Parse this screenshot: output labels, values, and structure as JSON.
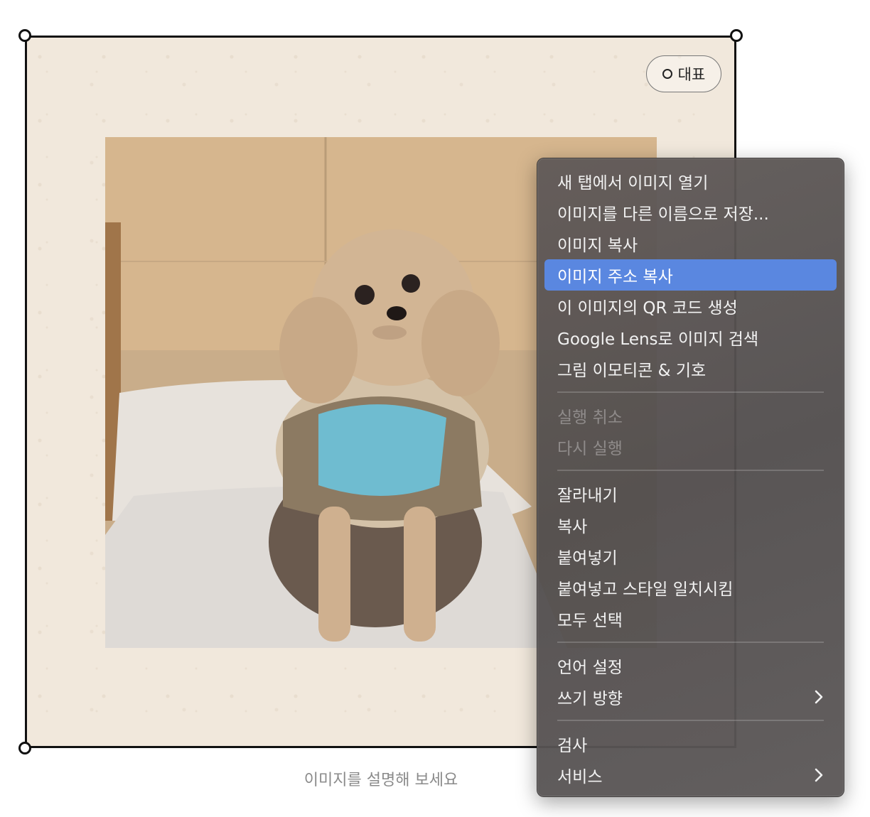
{
  "image_block": {
    "representative_label": "대표",
    "caption_placeholder": "이미지를 설명해 보세요"
  },
  "context_menu": {
    "group_image": [
      {
        "label": "새 탭에서 이미지 열기"
      },
      {
        "label": "이미지를 다른 이름으로 저장..."
      },
      {
        "label": "이미지 복사"
      },
      {
        "label": "이미지 주소 복사",
        "highlighted": true
      },
      {
        "label": "이 이미지의 QR 코드 생성"
      },
      {
        "label": "Google Lens로 이미지 검색"
      },
      {
        "label": "그림 이모티콘 & 기호"
      }
    ],
    "group_undo": [
      {
        "label": "실행 취소",
        "disabled": true
      },
      {
        "label": "다시 실행",
        "disabled": true
      }
    ],
    "group_edit": [
      {
        "label": "잘라내기"
      },
      {
        "label": "복사"
      },
      {
        "label": "붙여넣기"
      },
      {
        "label": "붙여넣고 스타일 일치시킴"
      },
      {
        "label": "모두 선택"
      }
    ],
    "group_language": [
      {
        "label": "언어 설정"
      },
      {
        "label": "쓰기 방향",
        "submenu": true
      }
    ],
    "group_tools": [
      {
        "label": "검사"
      },
      {
        "label": "서비스",
        "submenu": true
      }
    ]
  },
  "colors": {
    "highlight": "#5a87e0",
    "menu_bg": "#5e5a59",
    "canvas_bg": "#f1e8dc"
  }
}
